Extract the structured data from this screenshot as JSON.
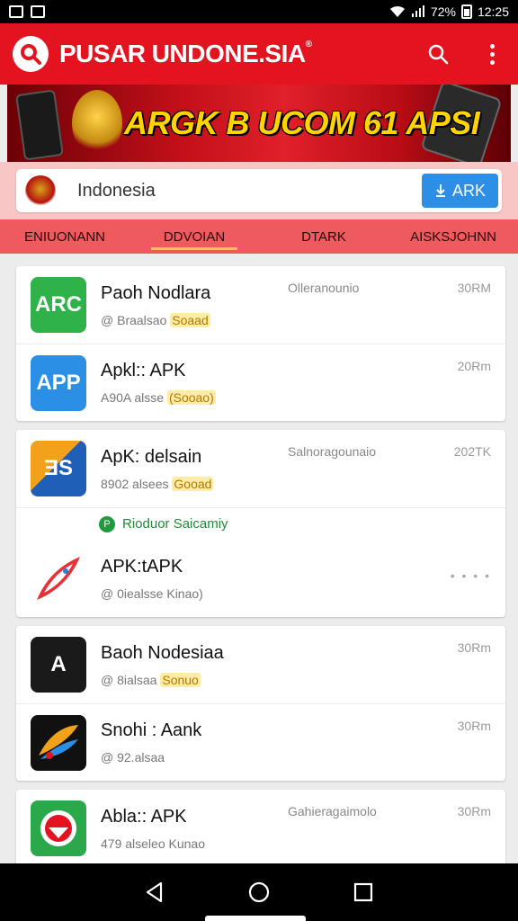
{
  "status_bar": {
    "battery": "72%",
    "time": "12:25"
  },
  "app_bar": {
    "title": "PUSAR UNDONE.SIA",
    "registered": "®"
  },
  "banner": {
    "text": "ARGK B UCOM 61 APSI"
  },
  "search": {
    "value": "Indonesia",
    "button_label": "ARK"
  },
  "tabs": [
    "ENIUONANN",
    "DDVOIAN",
    "DTARK",
    "AISKSJOHNN"
  ],
  "list": [
    {
      "title": "Paoh Nodlara",
      "sub": "@ Braalsao",
      "badge": "Soaad",
      "dev": "Olleranounio",
      "time": "30RM",
      "icon_text": "ARC",
      "icon_color": "#2fb24a"
    },
    {
      "title": "Apkl:: APK",
      "sub": "A90A alsse",
      "badge": "(Sooao)",
      "dev": "",
      "time": "20Rm",
      "icon_text": "APP",
      "icon_color": "#2b8fe6"
    },
    {
      "title": "ApK: delsain",
      "sub": "8902 alsees",
      "badge": "Gooad",
      "dev": "Salnoragounaio",
      "time": "202TK",
      "icon_text": "ƎS",
      "icon_color": "#1f5fb8"
    },
    {
      "title": "APK:tAPK",
      "sub": "@ 0iealsse Kinao)",
      "badge": "",
      "dev": "",
      "time": "",
      "icon_text": "",
      "icon_color": "#ffffff"
    },
    {
      "title": "Baoh Nodesiaa",
      "sub": "@ 8ialsaa",
      "badge": "Sonuo",
      "dev": "",
      "time": "30Rm",
      "icon_text": "A",
      "icon_color": "#1a1a1a"
    },
    {
      "title": "Snohi : Aank",
      "sub": "@ 92.alsaa",
      "badge": "",
      "dev": "",
      "time": "30Rm",
      "icon_text": "",
      "icon_color": "#111111"
    },
    {
      "title": "Abla:: APK",
      "sub": "479 alseleo Kunao",
      "badge": "",
      "dev": "Gahieragaimolo",
      "time": "30Rm",
      "icon_text": "",
      "icon_color": "#2aa84a"
    }
  ],
  "promo": {
    "text": "Rioduor Saicamiy",
    "icon": "P"
  },
  "colors": {
    "primary": "#e3141f",
    "accent": "#2d8ee6",
    "tab_bg": "#ef5a5e",
    "badge_bg": "#fdeca6"
  }
}
